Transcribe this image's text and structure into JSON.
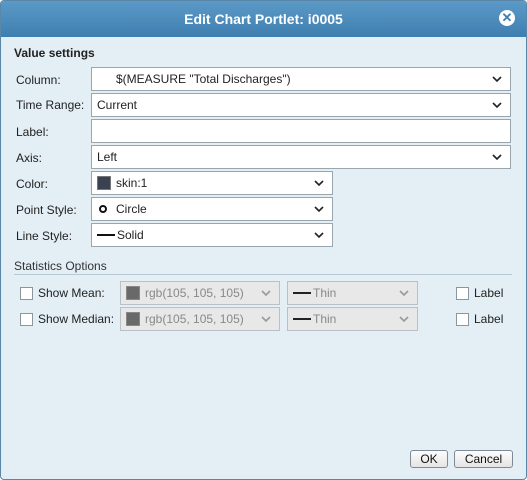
{
  "dialog": {
    "title": "Edit Chart Portlet: i0005",
    "close_icon": "close-icon"
  },
  "value_settings": {
    "heading": "Value settings",
    "column": {
      "label": "Column:",
      "value": "$(MEASURE \"Total Discharges\")"
    },
    "time_range": {
      "label": "Time Range:",
      "value": "Current"
    },
    "label_field": {
      "label": "Label:",
      "value": ""
    },
    "axis": {
      "label": "Axis:",
      "value": "Left"
    },
    "color": {
      "label": "Color:",
      "value": "skin:1",
      "swatch_color": "#3b4352"
    },
    "point_style": {
      "label": "Point Style:",
      "value": "Circle"
    },
    "line_style": {
      "label": "Line Style:",
      "value": "Solid"
    }
  },
  "statistics": {
    "heading": "Statistics Options",
    "mean": {
      "label": "Show Mean:",
      "checked": false,
      "color_value": "rgb(105, 105, 105)",
      "swatch_color": "#696969",
      "line_value": "Thin",
      "label_toggle": "Label"
    },
    "median": {
      "label": "Show Median:",
      "checked": false,
      "color_value": "rgb(105, 105, 105)",
      "swatch_color": "#696969",
      "line_value": "Thin",
      "label_toggle": "Label"
    }
  },
  "footer": {
    "ok_label": "OK",
    "cancel_label": "Cancel"
  }
}
